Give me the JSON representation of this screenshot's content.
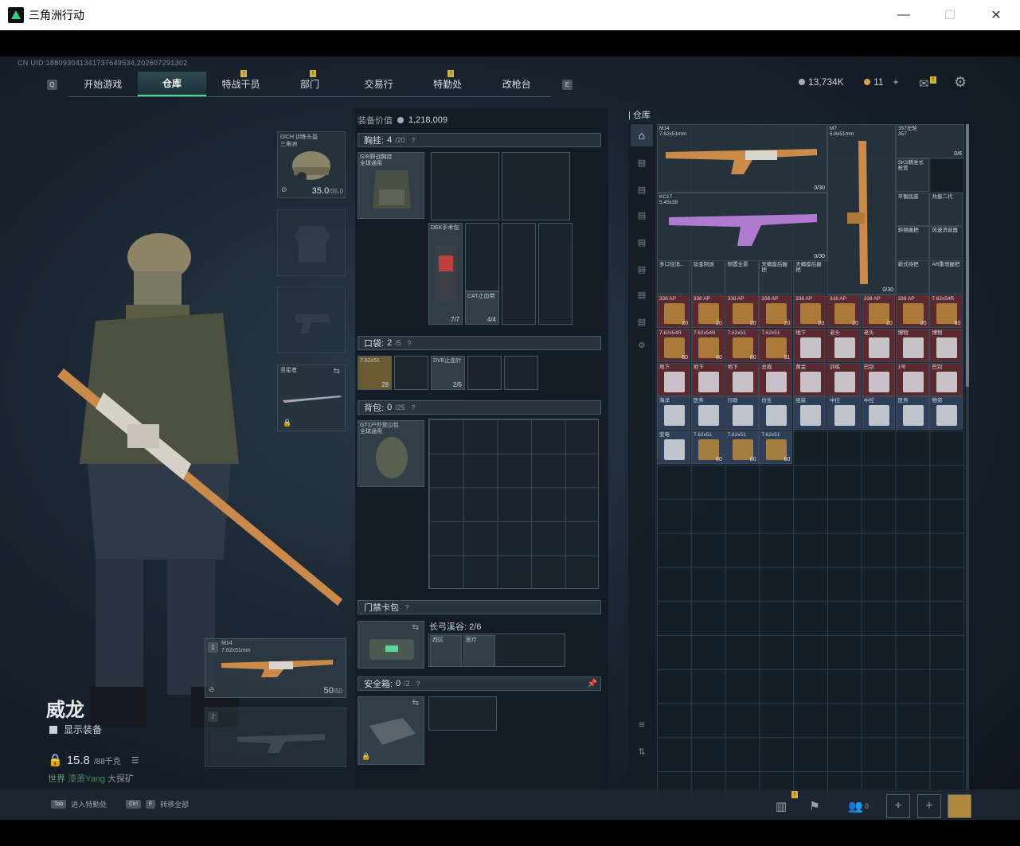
{
  "window": {
    "title": "三角洲行动",
    "minimize": "—",
    "maximize": "☐",
    "close": "✕"
  },
  "uid": "CN UID:1880930413417376495​34,202607291302",
  "nav": {
    "left_key": "Q",
    "right_key": "E",
    "items": [
      {
        "label": "开始游戏",
        "active": false,
        "badge": ""
      },
      {
        "label": "仓库",
        "active": true,
        "badge": ""
      },
      {
        "label": "特战干员",
        "active": false,
        "badge": "!"
      },
      {
        "label": "部门",
        "active": false,
        "badge": "!"
      },
      {
        "label": "交易行",
        "active": false,
        "badge": ""
      },
      {
        "label": "特勤处",
        "active": false,
        "badge": "!"
      },
      {
        "label": "改枪台",
        "active": false,
        "badge": ""
      }
    ]
  },
  "currency": {
    "silver": "13,734K",
    "gold": "11",
    "add": "+"
  },
  "gear": {
    "helmet": {
      "name": "DICH 训练头盔",
      "sub": "三角洲",
      "durability": "35.0",
      "max": "/35.0"
    },
    "melee": {
      "name": "坚星者"
    }
  },
  "character": {
    "name": "威龙",
    "show_gear": "显示装备",
    "weight": "15.8",
    "weight_max": "/88千克",
    "chat_channel": "世界",
    "chat_user": "漆萧Yang",
    "chat_text": "大探矿"
  },
  "primary_weapon": {
    "slot": "1",
    "name": "M14",
    "ammo_type": "7.62x51mm",
    "ammo": "50",
    "ammo_max": "/50"
  },
  "secondary_weapon": {
    "slot": "2"
  },
  "loadout": {
    "value_label": "装备价值",
    "value": "1,218,009",
    "chest": {
      "title": "胸挂:",
      "count": "4",
      "max": "/20",
      "item": "G/R野战胸挂",
      "item_sub": "全球通用"
    },
    "chest_items": [
      {
        "name": "DEK手术包",
        "count": "7/7"
      },
      {
        "name": "CAT止血带",
        "count": "4/4"
      }
    ],
    "pocket": {
      "title": "口袋:",
      "count": "2",
      "max": "/5"
    },
    "pocket_items": [
      {
        "name": "7.62x51",
        "count": "28"
      },
      {
        "name": "DVE止血针",
        "count": "2/5"
      }
    ],
    "backpack": {
      "title": "背包:",
      "count": "0",
      "max": "/25",
      "item": "GT1户外登山包",
      "item_sub": "全球通用"
    },
    "keycard": {
      "title": "门禁卡包",
      "zone": "长弓溪谷: 2/6",
      "cards": [
        "西区",
        "医疗"
      ]
    },
    "safebox": {
      "title": "安全箱:",
      "count": "0",
      "max": "/2"
    }
  },
  "warehouse": {
    "title": "仓库",
    "weapons": [
      {
        "name": "M14",
        "ammo_type": "7.62x51mm",
        "ammo": "0/30"
      },
      {
        "name": "M7",
        "ammo_type": "6.8x51mm",
        "ammo": "0/30"
      },
      {
        "name": "KC17",
        "ammo_type": "5.45x39",
        "ammo": "0/30"
      },
      {
        "name": "357左轮",
        "ammo_type": "357",
        "ammo": "0/6"
      }
    ],
    "attachments": [
      "SKS精准长枪管",
      "平衡底座",
      "共振二代",
      "斜侧握把",
      "风速消音器",
      "新式持把",
      "AR重增握把",
      "多口径消...",
      "钛金制退",
      "侧置全景",
      "天蝎座后握把",
      "天蝎座后握把"
    ],
    "ammo_row": [
      {
        "t": "338 AP",
        "n": "20"
      },
      {
        "t": "338 AP",
        "n": "20"
      },
      {
        "t": "338 AP",
        "n": "20"
      },
      {
        "t": "338 AP",
        "n": "20"
      },
      {
        "t": "338 AP",
        "n": "20"
      },
      {
        "t": "338 AP",
        "n": "20"
      },
      {
        "t": "338 AP",
        "n": "20"
      },
      {
        "t": "338 AP",
        "n": "20"
      },
      {
        "t": "7.62x54R",
        "n": "60"
      }
    ],
    "rows": [
      [
        {
          "t": "7.62x54R",
          "n": "60"
        },
        {
          "t": "7.62x54R",
          "n": "60"
        },
        {
          "t": "7.62x51",
          "n": "60"
        },
        {
          "t": "7.62x51",
          "n": "51"
        },
        {
          "t": "地下",
          "n": ""
        },
        {
          "t": "老头",
          "n": ""
        },
        {
          "t": "老头",
          "n": ""
        },
        {
          "t": "博物",
          "n": ""
        },
        {
          "t": "博物",
          "n": ""
        }
      ],
      [
        {
          "t": "地下",
          "n": ""
        },
        {
          "t": "地下",
          "n": ""
        },
        {
          "t": "地下",
          "n": ""
        },
        {
          "t": "总裁",
          "n": ""
        },
        {
          "t": "黄金",
          "n": ""
        },
        {
          "t": "训练",
          "n": ""
        },
        {
          "t": "巴别",
          "n": ""
        },
        {
          "t": "1号",
          "n": ""
        },
        {
          "t": "巴别",
          "n": ""
        }
      ],
      [
        {
          "t": "海洋",
          "n": ""
        },
        {
          "t": "医务",
          "n": ""
        },
        {
          "t": "行政",
          "n": ""
        },
        {
          "t": "仿生",
          "n": ""
        },
        {
          "t": "组装",
          "n": ""
        },
        {
          "t": "中控",
          "n": ""
        },
        {
          "t": "中控",
          "n": ""
        },
        {
          "t": "医务",
          "n": ""
        },
        {
          "t": "物资",
          "n": ""
        }
      ],
      [
        {
          "t": "变电",
          "n": ""
        },
        {
          "t": "7.62x51",
          "n": "60"
        },
        {
          "t": "7.62x51",
          "n": "60"
        },
        {
          "t": "7.62x51",
          "n": "60"
        }
      ]
    ]
  },
  "footer": {
    "enter_key": "Tab",
    "enter_label": "进入特勤处",
    "transfer_key1": "Ctrl",
    "transfer_key2": "F",
    "transfer_label": "转移全部",
    "party_count": "0"
  },
  "colors": {
    "accent": "#4fd6a0",
    "badge": "#d6b236",
    "gold_tile": "#b88a3a",
    "red_tile": "#5a2a30",
    "blue_tile": "#2e3e58"
  }
}
